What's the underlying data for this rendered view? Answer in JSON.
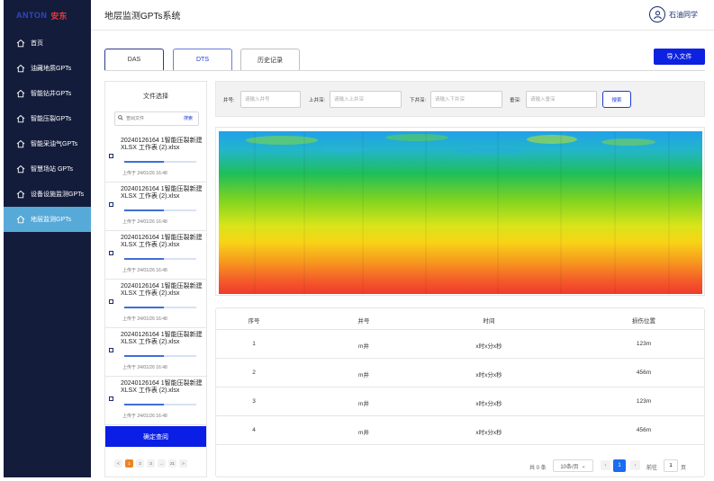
{
  "brand": {
    "en": "ANTON",
    "cn": "安东"
  },
  "header": {
    "title": "地层监测GPTs系统",
    "user": "石油同学"
  },
  "sidebar": {
    "items": [
      {
        "label": "首页",
        "active": false
      },
      {
        "label": "油藏地质GPTs",
        "active": false
      },
      {
        "label": "智能钻井GPTs",
        "active": false
      },
      {
        "label": "智能压裂GPTs",
        "active": false
      },
      {
        "label": "智能采油气GPTs",
        "active": false
      },
      {
        "label": "智慧场站 GPTs",
        "active": false
      },
      {
        "label": "设备设施监测GPTs",
        "active": false
      },
      {
        "label": "地层监测GPTs",
        "active": true
      }
    ]
  },
  "tabs": [
    {
      "label": "DAS"
    },
    {
      "label": "DTS"
    },
    {
      "label": "历史记录"
    }
  ],
  "import_button": "导入文件",
  "file_panel": {
    "title": "文件选择",
    "search_placeholder": "查阅文件",
    "search_button": "搜索",
    "files": [
      {
        "name": "20240126164 1智能压裂新建 XLSX 工作表 (2).xlsx",
        "progress": 0.55,
        "uploaded": "上传于 24/01/26 16:48"
      },
      {
        "name": "20240126164 1智能压裂新建 XLSX 工作表 (2).xlsx",
        "progress": 0.55,
        "uploaded": "上传于 24/01/26 16:48"
      },
      {
        "name": "20240126164 1智能压裂新建 XLSX 工作表 (2).xlsx",
        "progress": 0.55,
        "uploaded": "上传于 24/01/26 16:48"
      },
      {
        "name": "20240126164 1智能压裂新建 XLSX 工作表 (2).xlsx",
        "progress": 0.55,
        "uploaded": "上传于 24/01/26 16:48"
      },
      {
        "name": "20240126164 1智能压裂新建 XLSX 工作表 (2).xlsx",
        "progress": 0.55,
        "uploaded": "上传于 24/01/26 16:48"
      },
      {
        "name": "20240126164 1智能压裂新建 XLSX 工作表 (2).xlsx",
        "progress": 0.55,
        "uploaded": "上传于 24/01/26 16:48"
      }
    ],
    "confirm_button": "确定查阅",
    "pager": {
      "prev": "<",
      "pages": [
        "1",
        "2",
        "3",
        "...",
        "21"
      ],
      "next": ">"
    }
  },
  "query": {
    "well_label": "井号:",
    "well_placeholder": "请输入井号",
    "top_label": "上井深:",
    "top_placeholder": "请输入上井深",
    "bottom_label": "下井深:",
    "bottom_placeholder": "请输入下井深",
    "depth_label": "垂深:",
    "depth_placeholder": "请输入垂深",
    "search_button": "搜索"
  },
  "table": {
    "headers": [
      "序号",
      "井号",
      "时间",
      "损伤位置"
    ],
    "rows": [
      [
        "1",
        "m井",
        "x时x分x秒",
        "123m"
      ],
      [
        "2",
        "m井",
        "x时x分x秒",
        "456m"
      ],
      [
        "3",
        "m井",
        "x时x分x秒",
        "123m"
      ],
      [
        "4",
        "m井",
        "x时x分x秒",
        "456m"
      ]
    ]
  },
  "pager": {
    "total": "共 0 条",
    "page_size": "10条/页",
    "prev": "‹",
    "current": "1",
    "next": "›",
    "goto_label": "前往",
    "goto_value": "1",
    "page_suffix": "页"
  },
  "colors": {
    "sidebar_bg": "#141c3c",
    "active_item": "#57a9d8",
    "primary": "#0c22e0",
    "pager_active": "#1a6cf0"
  }
}
